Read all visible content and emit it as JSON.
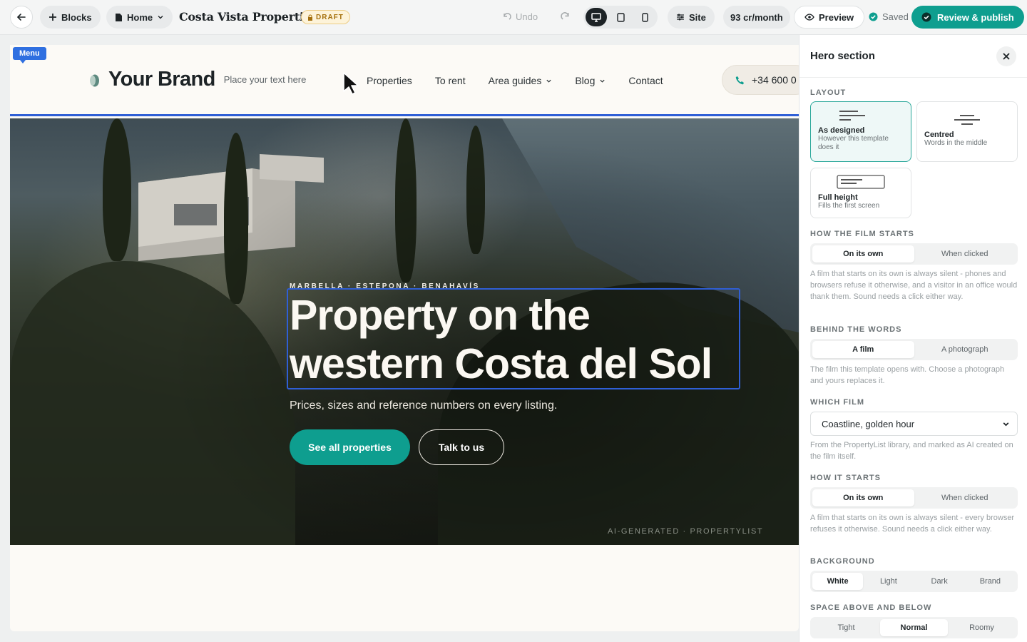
{
  "topbar": {
    "blocks_label": "Blocks",
    "page_label": "Home",
    "site_name": "Costa Vista Properties",
    "draft_badge": "DRAFT",
    "undo_label": "Undo",
    "site_label": "Site",
    "credits": "93 cr/month",
    "preview_label": "Preview",
    "saved_label": "Saved",
    "publish_label": "Review & publish",
    "active_device": "desktop"
  },
  "canvas": {
    "menu_tag": "Menu",
    "brand": "Your Brand",
    "tagline": "Place your text here",
    "nav": [
      {
        "label": "Properties",
        "dropdown": false
      },
      {
        "label": "To rent",
        "dropdown": false
      },
      {
        "label": "Area guides",
        "dropdown": true
      },
      {
        "label": "Blog",
        "dropdown": true
      },
      {
        "label": "Contact",
        "dropdown": false
      }
    ],
    "phone": "+34 600 0",
    "hero": {
      "eyebrow": "MARBELLA · ESTEPONA · BENAHAVÍS",
      "title": "Property on the western Costa del Sol",
      "subtitle": "Prices, sizes and reference numbers on every listing.",
      "cta_primary": "See all properties",
      "cta_secondary": "Talk to us",
      "credit": "AI-GENERATED · PROPERTYLIST"
    }
  },
  "panel": {
    "title": "Hero section",
    "layout_label": "LAYOUT",
    "layouts": [
      {
        "title": "As designed",
        "desc": "However this template does it",
        "selected": true
      },
      {
        "title": "Centred",
        "desc": "Words in the middle",
        "selected": false
      },
      {
        "title": "Full height",
        "desc": "Fills the first screen",
        "selected": false
      }
    ],
    "film_starts_label": "HOW THE FILM STARTS",
    "film_starts_options": [
      "On its own",
      "When clicked"
    ],
    "film_starts_selected": "On its own",
    "film_starts_help": "A film that starts on its own is always silent - phones and browsers refuse it otherwise, and a visitor in an office would thank them. Sound needs a click either way.",
    "behind_label": "BEHIND THE WORDS",
    "behind_options": [
      "A film",
      "A photograph"
    ],
    "behind_selected": "A film",
    "behind_help": "The film this template opens with. Choose a photograph and yours replaces it.",
    "which_film_label": "WHICH FILM",
    "which_film_value": "Coastline, golden hour",
    "which_film_help": "From the PropertyList library, and marked as AI created on the film itself.",
    "how_starts_label": "HOW IT STARTS",
    "how_starts_options": [
      "On its own",
      "When clicked"
    ],
    "how_starts_selected": "On its own",
    "how_starts_help": "A film that starts on its own is always silent - every browser refuses it otherwise. Sound needs a click either way.",
    "background_label": "BACKGROUND",
    "background_options": [
      "White",
      "Light",
      "Dark",
      "Brand"
    ],
    "background_selected": "White",
    "space_label": "SPACE ABOVE AND BELOW",
    "space_options": [
      "Tight",
      "Normal",
      "Roomy"
    ],
    "space_selected": "Normal"
  },
  "colors": {
    "accent": "#0e9e8f",
    "selection": "#2f5fd6",
    "draft_bg": "#fdf3d9"
  }
}
